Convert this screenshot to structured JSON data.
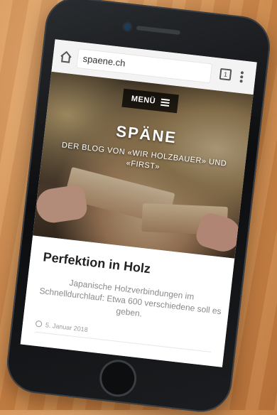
{
  "browser": {
    "url": "spaene.ch",
    "tab_count": "1"
  },
  "site": {
    "menu_label": "MENÜ",
    "title": "SPÄNE",
    "subtitle": "DER BLOG VON «WIR HOLZBAUER» UND «FIRST»"
  },
  "article": {
    "title": "Perfektion in Holz",
    "teaser": "Japanische Holzverbindungen im Schnelldurchlauf: Etwa 600 verschiedene soll es geben.",
    "date": "5. Januar 2018"
  },
  "icons": {
    "home": "home-icon",
    "tabs": "tabs-icon",
    "more": "kebab-menu-icon",
    "menu": "hamburger-icon",
    "date": "clock-icon"
  }
}
